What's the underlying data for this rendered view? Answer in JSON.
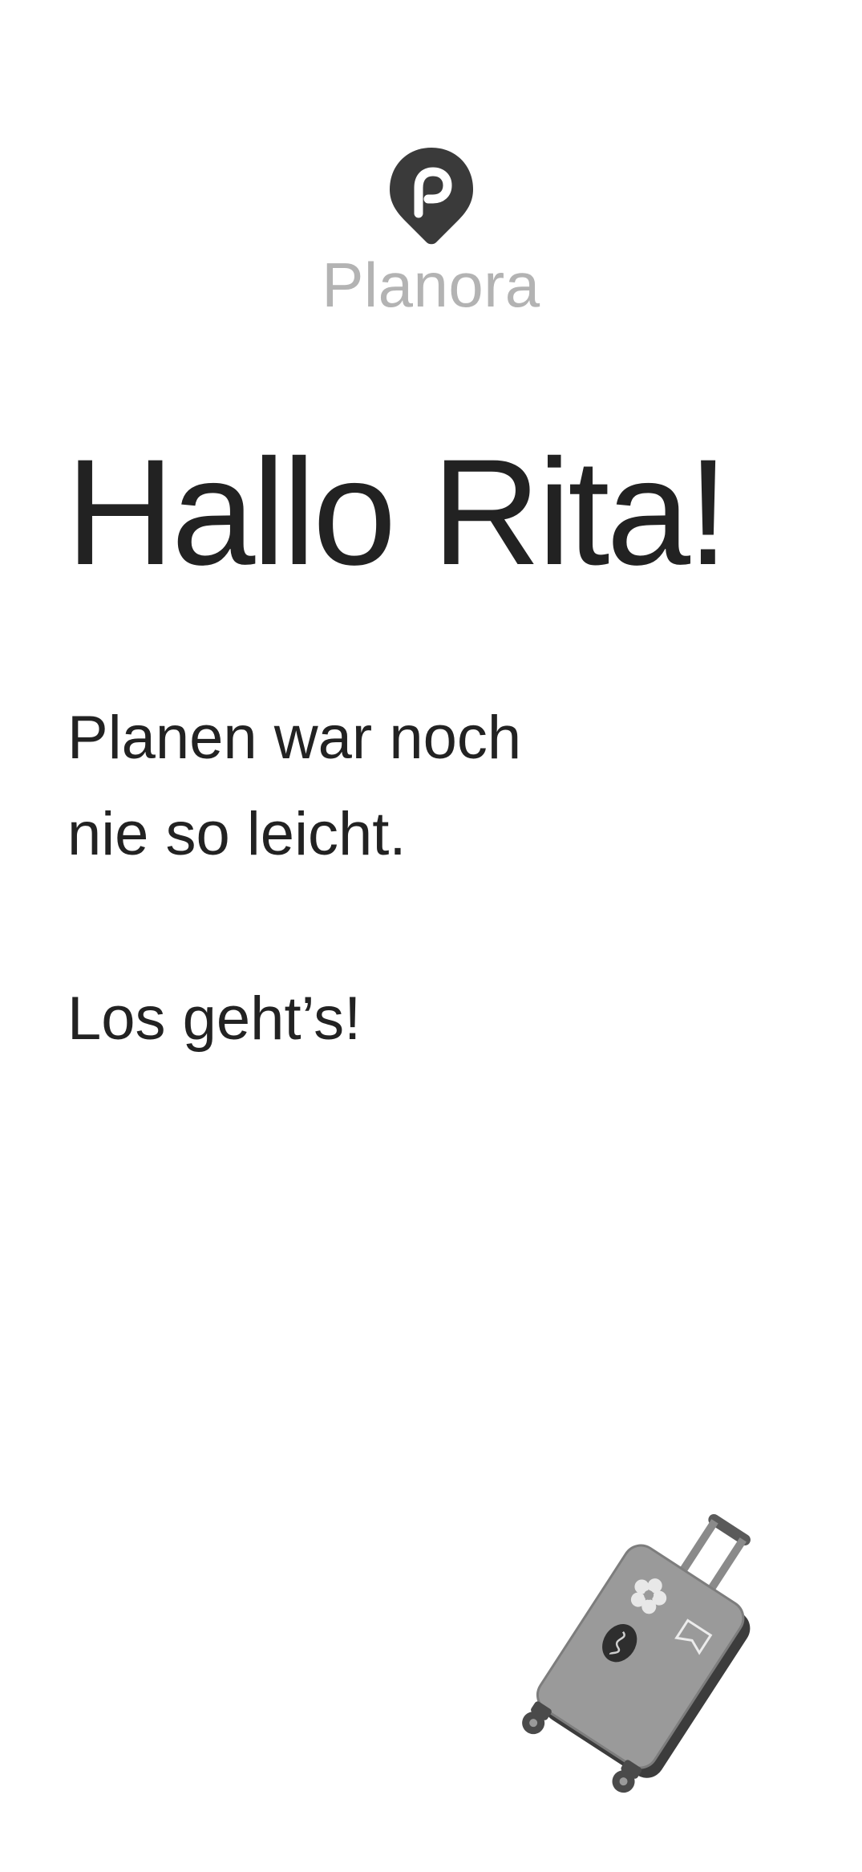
{
  "brand": {
    "name": "Planora",
    "logo_icon": "map-pin-p-icon"
  },
  "greeting": {
    "title": "Hallo Rita!"
  },
  "tagline": {
    "line1": "Planen war noch",
    "line2": "nie so leicht."
  },
  "cta": {
    "text": "Los geht’s!"
  },
  "illustration": {
    "icon": "suitcase-illustration"
  },
  "colors": {
    "text": "#222222",
    "brand_name": "#b3b3b3",
    "logo": "#3a3a3a",
    "background": "#ffffff"
  }
}
